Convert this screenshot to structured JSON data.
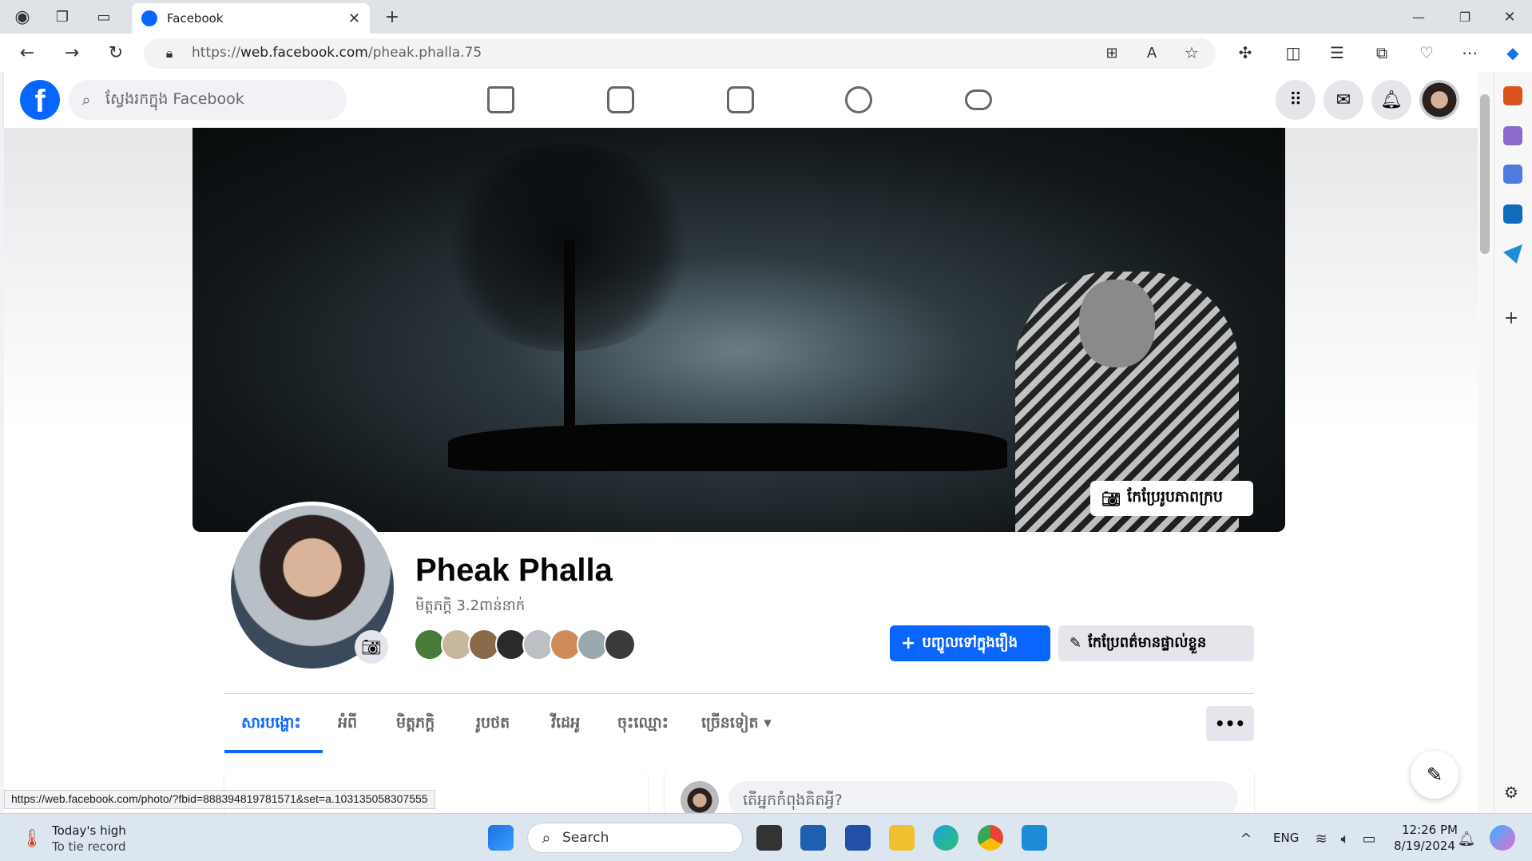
{
  "browser": {
    "tab_title": "Facebook",
    "url_prefix": "https://",
    "url_domain": "web.facebook.com",
    "url_path": "/pheak.phalla.75",
    "new_tab": "+"
  },
  "header": {
    "logo": "f",
    "search_placeholder": "ស្វែងរកក្នុង Facebook"
  },
  "profile": {
    "name": "Pheak Phalla",
    "friends": "មិត្តភក្តិ 3.2ពាន់នាក់",
    "edit_cover": "កែប្រែរូបភាពក្រប",
    "add_story": "បញ្ចូលទៅក្នុងរឿង",
    "edit_profile": "កែប្រែពត៌មានផ្ទាល់ខ្លួន",
    "more_dots": "•••"
  },
  "tabs": [
    {
      "label": "សារបង្ហោះ"
    },
    {
      "label": "អំពី"
    },
    {
      "label": "មិត្តភក្តិ"
    },
    {
      "label": "រូបថត"
    },
    {
      "label": "វីដេអូ"
    },
    {
      "label": "ចុះឈ្មោះ"
    },
    {
      "label": "ច្រើនទៀត ▾"
    }
  ],
  "composer": {
    "placeholder": "តើអ្នកកំពុងគិតអ្វី?"
  },
  "status_url": "https://web.facebook.com/photo/?fbid=888394819781571&set=a.103135058307555",
  "taskbar": {
    "weather_title": "Today's high",
    "weather_sub": "To tie record",
    "search": "Search",
    "lang": "ENG",
    "time": "12:26 PM",
    "date": "8/19/2024"
  },
  "colors": {
    "fb_blue": "#0866ff",
    "secondary_text": "#65676b"
  }
}
